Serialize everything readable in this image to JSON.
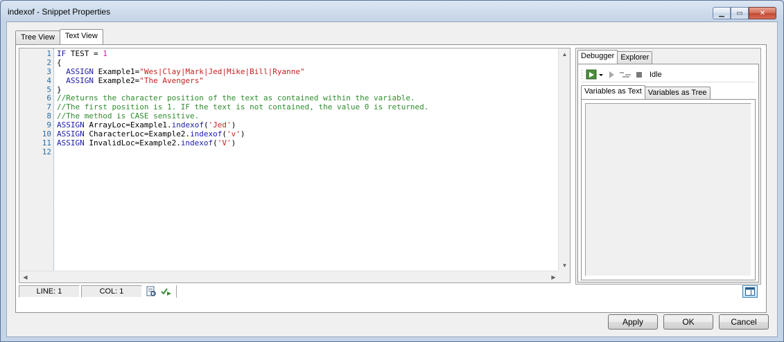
{
  "window": {
    "title": "indexof - Snippet Properties",
    "minimize_glyph": "▁",
    "maximize_glyph": "▭",
    "close_glyph": "✕"
  },
  "tabs": [
    {
      "label": "Tree View",
      "active": false
    },
    {
      "label": "Text View",
      "active": true
    }
  ],
  "editor": {
    "line_numbers": [
      "1",
      "2",
      "3",
      "4",
      "5",
      "6",
      "7",
      "8",
      "9",
      "10",
      "11",
      "12"
    ],
    "lines": [
      [
        {
          "t": "kw",
          "v": "IF "
        },
        {
          "t": "id",
          "v": "TEST = "
        },
        {
          "t": "num",
          "v": "1"
        }
      ],
      [
        {
          "t": "id",
          "v": "{"
        }
      ],
      [
        {
          "t": "id",
          "v": "  "
        },
        {
          "t": "kw",
          "v": "ASSIGN "
        },
        {
          "t": "id",
          "v": "Example1="
        },
        {
          "t": "str",
          "v": "\"Wes|Clay|Mark|Jed|Mike|Bill|Ryanne\""
        }
      ],
      [
        {
          "t": "id",
          "v": "  "
        },
        {
          "t": "kw",
          "v": "ASSIGN "
        },
        {
          "t": "id",
          "v": "Example2="
        },
        {
          "t": "str",
          "v": "\"The Avengers\""
        }
      ],
      [
        {
          "t": "id",
          "v": "}"
        }
      ],
      [
        {
          "t": "cmt",
          "v": "//Returns the character position of the text as contained within the variable."
        }
      ],
      [
        {
          "t": "cmt",
          "v": "//The first position is 1. IF the text is not contained, the value 0 is returned."
        }
      ],
      [
        {
          "t": "cmt",
          "v": "//The method is CASE sensitive."
        }
      ],
      [
        {
          "t": "kw",
          "v": "ASSIGN "
        },
        {
          "t": "id",
          "v": "ArrayLoc=Example1."
        },
        {
          "t": "fn",
          "v": "indexof"
        },
        {
          "t": "id",
          "v": "("
        },
        {
          "t": "str",
          "v": "'Jed'"
        },
        {
          "t": "id",
          "v": ")"
        }
      ],
      [
        {
          "t": "kw",
          "v": "ASSIGN "
        },
        {
          "t": "id",
          "v": "CharacterLoc=Example2."
        },
        {
          "t": "fn",
          "v": "indexof"
        },
        {
          "t": "id",
          "v": "("
        },
        {
          "t": "str",
          "v": "'v'"
        },
        {
          "t": "id",
          "v": ")"
        }
      ],
      [
        {
          "t": "kw",
          "v": "ASSIGN "
        },
        {
          "t": "id",
          "v": "InvalidLoc=Example2."
        },
        {
          "t": "fn",
          "v": "indexof"
        },
        {
          "t": "id",
          "v": "("
        },
        {
          "t": "str",
          "v": "'V'"
        },
        {
          "t": "id",
          "v": ")"
        }
      ],
      []
    ]
  },
  "status": {
    "line": "LINE: 1",
    "col": "COL: 1"
  },
  "debugger": {
    "tabs": [
      {
        "label": "Debugger",
        "active": true
      },
      {
        "label": "Explorer",
        "active": false
      }
    ],
    "state": "Idle",
    "inner_tabs": [
      {
        "label": "Variables as Text",
        "active": true
      },
      {
        "label": "Variables as Tree",
        "active": false
      }
    ]
  },
  "buttons": {
    "apply": "Apply",
    "ok": "OK",
    "cancel": "Cancel"
  },
  "icons": [
    "minimize-icon",
    "maximize-icon",
    "close-icon",
    "run-icon",
    "dropdown-arrow-icon",
    "step-icon",
    "step-over-icon",
    "stop-icon",
    "find-icon",
    "check-syntax-icon",
    "panel-toggle-icon"
  ]
}
